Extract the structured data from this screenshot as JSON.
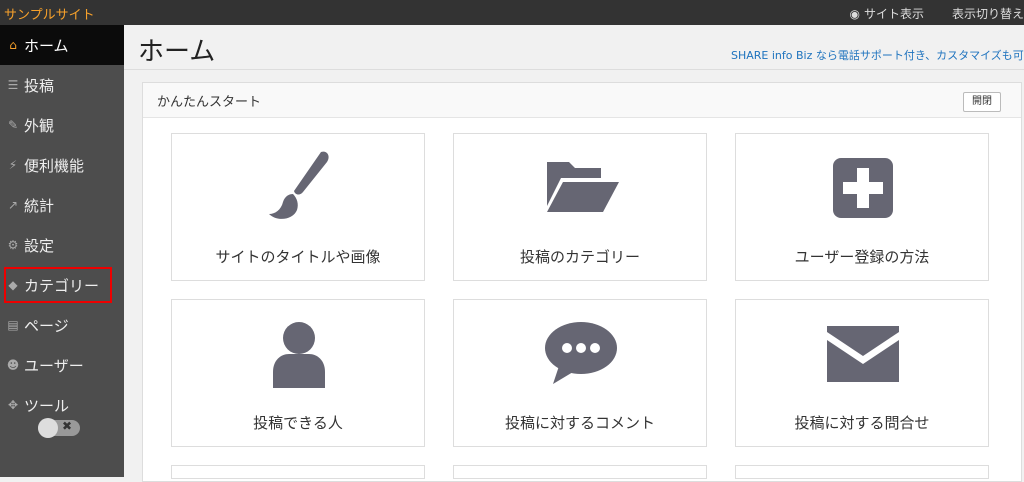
{
  "topbar": {
    "site_name": "サンプルサイト",
    "view_site": "サイト表示",
    "switch_view": "表示切り替え"
  },
  "sidebar": {
    "items": [
      {
        "label": "ホーム",
        "icon": "home-icon"
      },
      {
        "label": "投稿",
        "icon": "list-icon"
      },
      {
        "label": "外観",
        "icon": "brush-icon"
      },
      {
        "label": "便利機能",
        "icon": "plugin-icon"
      },
      {
        "label": "統計",
        "icon": "chart-icon"
      },
      {
        "label": "設定",
        "icon": "gear-icon"
      },
      {
        "label": "カテゴリー",
        "icon": "tag-icon"
      },
      {
        "label": "ページ",
        "icon": "page-icon"
      },
      {
        "label": "ユーザー",
        "icon": "users-icon"
      },
      {
        "label": "ツール",
        "icon": "wrench-icon"
      }
    ],
    "active_index": 0,
    "highlighted_index": 6
  },
  "main": {
    "title": "ホーム",
    "promo": "SHARE info Biz なら電話サポート付き、カスタマイズも可。"
  },
  "panel": {
    "title": "かんたんスタート",
    "toggle_label": "開閉",
    "cards": [
      {
        "label": "サイトのタイトルや画像",
        "icon": "paintbrush-icon"
      },
      {
        "label": "投稿のカテゴリー",
        "icon": "folder-open-icon"
      },
      {
        "label": "ユーザー登録の方法",
        "icon": "plus-square-icon"
      },
      {
        "label": "投稿できる人",
        "icon": "user-icon"
      },
      {
        "label": "投稿に対するコメント",
        "icon": "comment-icon"
      },
      {
        "label": "投稿に対する問合せ",
        "icon": "envelope-icon"
      }
    ]
  },
  "colors": {
    "accent": "#f7a12b",
    "sidebar_bg": "#4d4d4d",
    "icon_fill": "#666673",
    "highlight_border": "#e00000",
    "link": "#1e73be"
  }
}
